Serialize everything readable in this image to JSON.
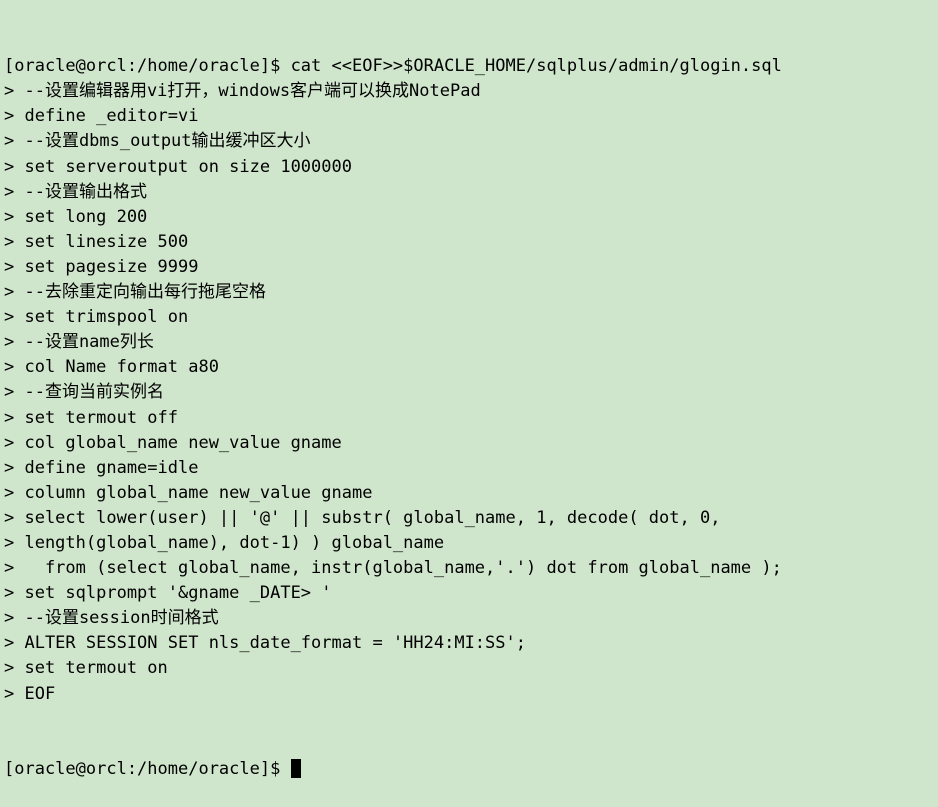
{
  "terminal": {
    "shell_user_host_path": "[oracle@orcl:/home/oracle]$",
    "continuation_prompt": ">",
    "background_color": "#cfe6cc",
    "foreground_color": "#000000",
    "cursor": {
      "shape": "block",
      "color": "#000000"
    },
    "lines": [
      "[oracle@orcl:/home/oracle]$ cat <<EOF>>$ORACLE_HOME/sqlplus/admin/glogin.sql",
      "> --设置编辑器用vi打开，windows客户端可以换成NotePad",
      "> define _editor=vi",
      "> --设置dbms_output输出缓冲区大小",
      "> set serveroutput on size 1000000",
      "> --设置输出格式",
      "> set long 200",
      "> set linesize 500",
      "> set pagesize 9999",
      "> --去除重定向输出每行拖尾空格",
      "> set trimspool on",
      "> --设置name列长",
      "> col Name format a80",
      "> --查询当前实例名",
      "> set termout off",
      "> col global_name new_value gname",
      "> define gname=idle",
      "> column global_name new_value gname",
      "> select lower(user) || '@' || substr( global_name, 1, decode( dot, 0,",
      "> length(global_name), dot-1) ) global_name",
      ">   from (select global_name, instr(global_name,'.') dot from global_name );",
      "> set sqlprompt '&gname _DATE> '",
      "> --设置session时间格式",
      "> ALTER SESSION SET nls_date_format = 'HH24:MI:SS';",
      "> set termout on",
      "> EOF"
    ],
    "final_prompt": "[oracle@orcl:/home/oracle]$ "
  }
}
